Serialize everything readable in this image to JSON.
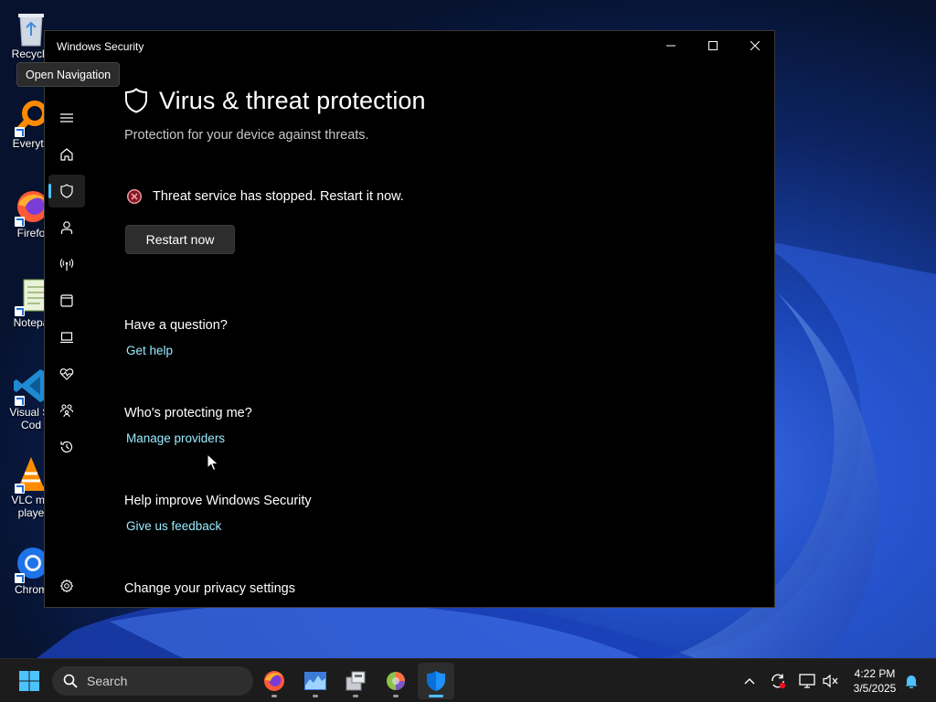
{
  "window": {
    "title": "Windows Security",
    "controls": {
      "minimize": "minimize-icon",
      "maximize": "maximize-icon",
      "close": "close-icon"
    }
  },
  "tooltip": "Open Navigation",
  "nav": {
    "items": [
      {
        "name": "hamburger-menu",
        "icon": "hamburger-icon"
      },
      {
        "name": "home",
        "icon": "home-icon"
      },
      {
        "name": "virus-threat-protection",
        "icon": "shield-icon",
        "active": true
      },
      {
        "name": "account-protection",
        "icon": "person-icon"
      },
      {
        "name": "firewall-network",
        "icon": "antenna-icon"
      },
      {
        "name": "app-browser-control",
        "icon": "browser-window-icon"
      },
      {
        "name": "device-security",
        "icon": "laptop-icon"
      },
      {
        "name": "device-performance-health",
        "icon": "heart-pulse-icon"
      },
      {
        "name": "family-options",
        "icon": "family-icon"
      },
      {
        "name": "protection-history",
        "icon": "history-icon"
      },
      {
        "name": "settings",
        "icon": "gear-icon"
      }
    ]
  },
  "page": {
    "title": "Virus & threat protection",
    "subtitle": "Protection for your device against threats.",
    "alert": "Threat service has stopped. Restart it now.",
    "restart_button": "Restart now",
    "sections": [
      {
        "heading": "Have a question?",
        "link": "Get help"
      },
      {
        "heading": "Who's protecting me?",
        "link": "Manage providers"
      },
      {
        "heading": "Help improve Windows Security",
        "link": "Give us feedback"
      },
      {
        "heading": "Change your privacy settings"
      }
    ]
  },
  "desktop": {
    "icons": [
      {
        "label": "Recycle",
        "icon": "recycle-bin-icon"
      },
      {
        "label": "Everyth",
        "icon": "everything-search-icon"
      },
      {
        "label": "Firefo",
        "icon": "firefox-icon"
      },
      {
        "label": "Notepa",
        "icon": "notepad-icon"
      },
      {
        "label": "Visual St\nCod",
        "icon": "vscode-icon"
      },
      {
        "label": "VLC me\nplaye",
        "icon": "vlc-icon"
      },
      {
        "label": "Chrom",
        "icon": "chrome-icon"
      }
    ]
  },
  "taskbar": {
    "search_placeholder": "Search",
    "apps": [
      "windows-start-icon",
      "firefox-icon",
      "task-manager-icon",
      "file-tool-icon",
      "color-wheel-icon",
      "windows-security-icon"
    ],
    "tray": [
      "chevron-up-icon",
      "sync-icon",
      "network-icon",
      "volume-muted-icon",
      "notification-bell-icon"
    ],
    "time": "4:22 PM",
    "date": "3/5/2025"
  },
  "colors": {
    "accent": "#4cc2ff",
    "link": "#99ebff",
    "error": "#ff99a4",
    "window_bg": "#000000",
    "taskbar_bg": "#1c1c1c"
  }
}
